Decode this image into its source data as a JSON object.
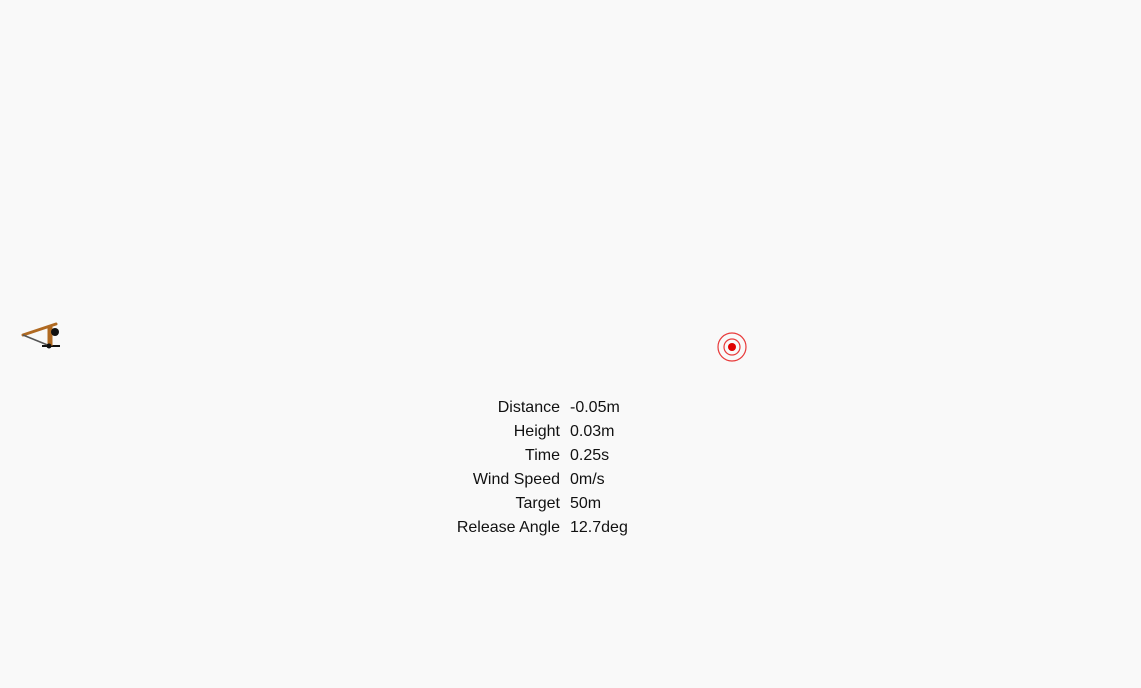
{
  "colors": {
    "background": "#f9f9f9",
    "target_ring": "#e83a3a",
    "target_center": "#e00000",
    "trebuchet_wood": "#b06a22",
    "trebuchet_dark": "#111111"
  },
  "icons": {
    "trebuchet": "trebuchet-icon",
    "target": "target-icon"
  },
  "stats": [
    {
      "label": "Distance",
      "value": "-0.05m"
    },
    {
      "label": "Height",
      "value": "0.03m"
    },
    {
      "label": "Time",
      "value": "0.25s"
    },
    {
      "label": "Wind Speed",
      "value": "0m/s"
    },
    {
      "label": "Target",
      "value": "50m"
    },
    {
      "label": "Release Angle",
      "value": "12.7deg"
    }
  ]
}
